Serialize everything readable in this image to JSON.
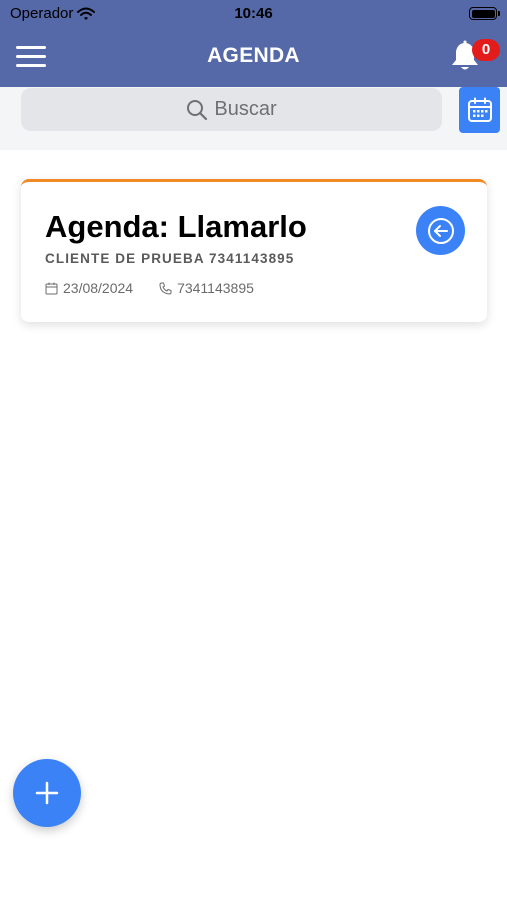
{
  "status_bar": {
    "carrier": "Operador",
    "time": "10:46"
  },
  "header": {
    "title": "AGENDA",
    "notification_count": "0"
  },
  "search": {
    "placeholder": "Buscar"
  },
  "agenda_items": [
    {
      "title": "Agenda: Llamarlo",
      "client": "CLIENTE DE PRUEBA 7341143895",
      "date": "23/08/2024",
      "phone": "7341143895"
    }
  ],
  "colors": {
    "header_bg": "#5568a8",
    "accent": "#3b82f6",
    "card_border_top": "#f08a24",
    "badge": "#e31b1b"
  },
  "icons": {
    "menu": "menu-icon",
    "bell": "bell-icon",
    "search": "search-icon",
    "calendar": "calendar-icon",
    "back": "arrow-left-circle-icon",
    "date": "calendar-small-icon",
    "phone": "phone-icon",
    "add": "plus-icon"
  }
}
